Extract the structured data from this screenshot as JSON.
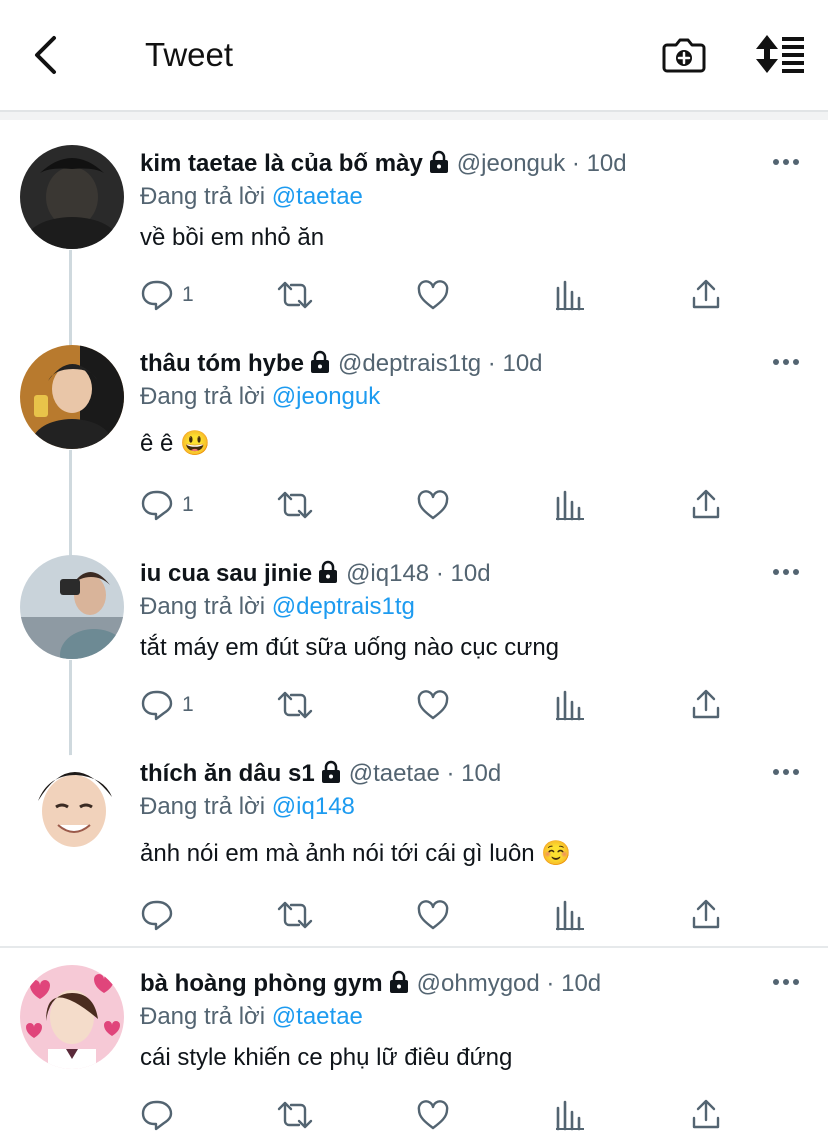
{
  "header": {
    "title": "Tweet",
    "back_icon": "chevron-left-icon",
    "camera_icon": "camera-plus-icon",
    "sort_icon": "sort-list-icon"
  },
  "colors": {
    "link": "#1d9bf0",
    "secondary_text": "#536471",
    "primary_text": "#0f1419"
  },
  "tweets": [
    {
      "name": "kim taetae là của bố mày",
      "handle": "@jeonguk",
      "dot": "·",
      "time": "10d",
      "replying_prefix": "Đang trả lời",
      "replying_to": "@taetae",
      "text": "về bồi em nhỏ ăn",
      "reply_count": "1"
    },
    {
      "name": "thâu tóm hybe",
      "handle": "@deptrais1tg",
      "dot": "·",
      "time": "10d",
      "replying_prefix": "Đang trả lời",
      "replying_to": "@jeonguk",
      "text": "ê ê 😃",
      "reply_count": "1"
    },
    {
      "name": "iu cua sau jinie",
      "handle": "@iq148",
      "dot": "·",
      "time": "10d",
      "replying_prefix": "Đang trả lời",
      "replying_to": "@deptrais1tg",
      "text": "tắt máy em đút sữa uống nào cục cưng",
      "reply_count": "1"
    },
    {
      "name": "thích ăn dâu s1",
      "handle": "@taetae",
      "dot": "·",
      "time": "10d",
      "replying_prefix": "Đang trả lời",
      "replying_to": "@iq148",
      "text": "ảnh nói em mà ảnh nói tới cái gì luôn ☺️",
      "reply_count": ""
    },
    {
      "name": "bà hoàng phòng gym",
      "handle": "@ohmygod",
      "dot": "·",
      "time": "10d",
      "replying_prefix": "Đang trả lời",
      "replying_to": "@taetae",
      "text": "cái style khiến ce phụ lữ điêu đứng",
      "reply_count": ""
    }
  ]
}
